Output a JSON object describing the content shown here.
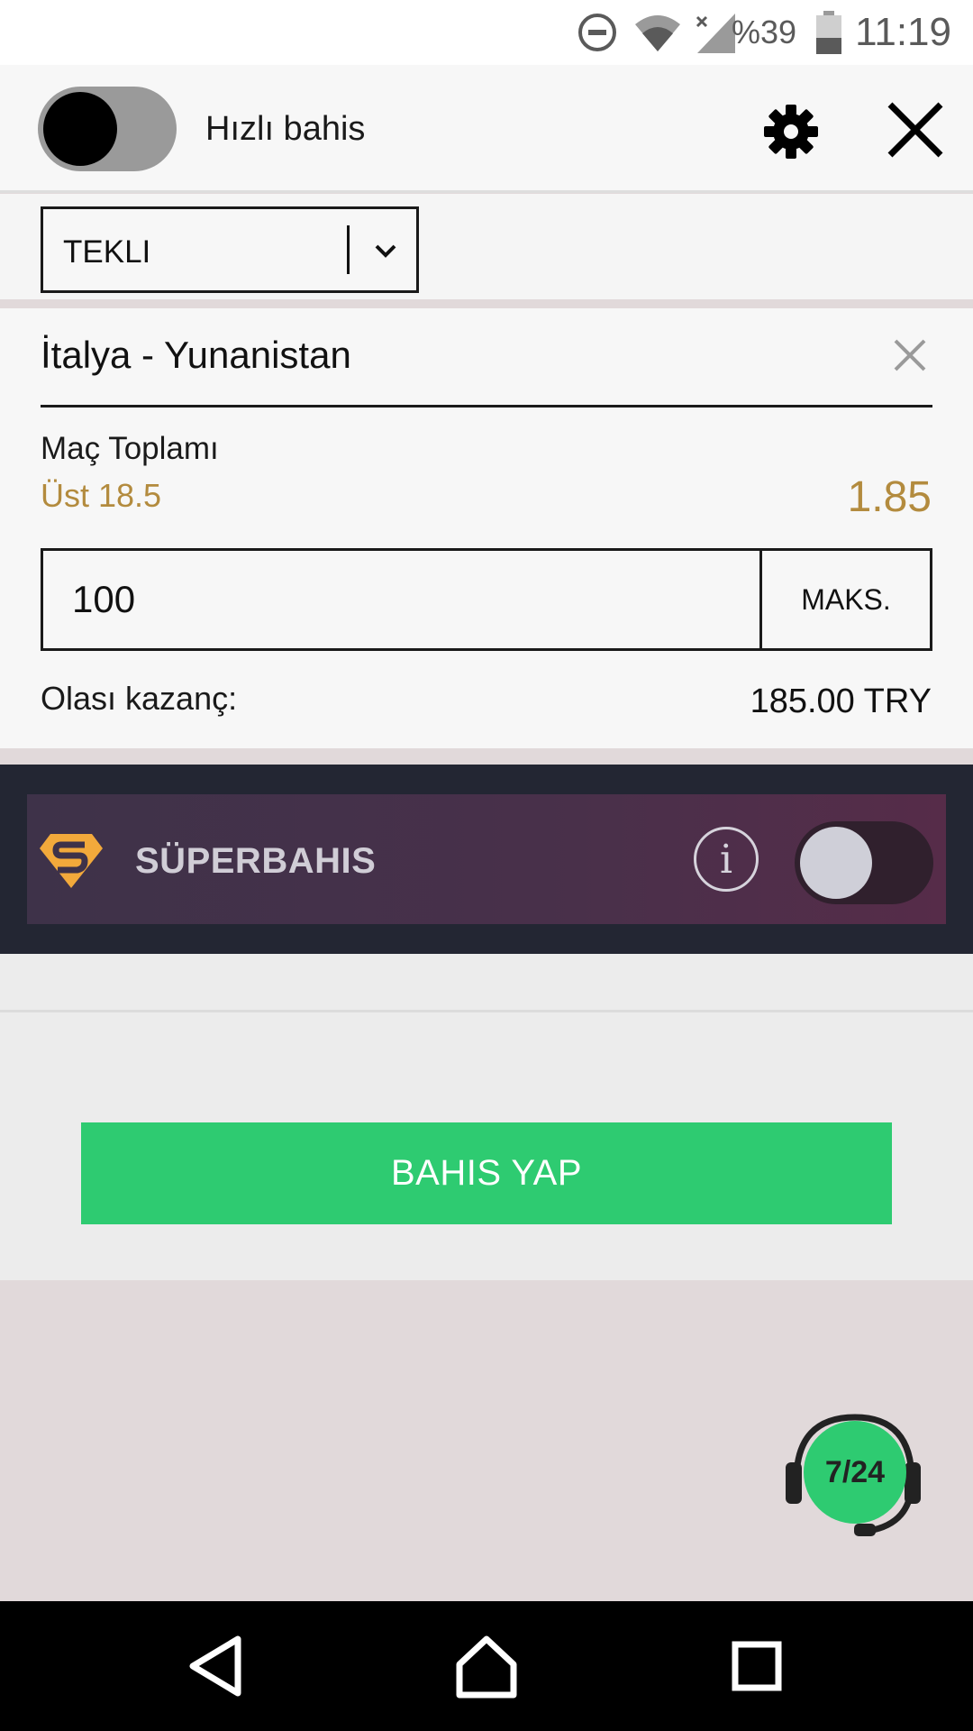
{
  "status_bar": {
    "battery": "%39",
    "time": "11:19",
    "icons": [
      "do-not-disturb-icon",
      "wifi-icon",
      "signal-icon",
      "battery-icon"
    ]
  },
  "header": {
    "quick_bet_label": "Hızlı bahis",
    "quick_bet_enabled": false
  },
  "bet_type": {
    "selected": "TEKLI"
  },
  "bet": {
    "match": "İtalya - Yunanistan",
    "market": "Maç Toplamı",
    "selection": "Üst 18.5",
    "odds": "1.85",
    "stake": "100",
    "max_label": "MAKS.",
    "potential_win_label": "Olası kazanç:",
    "potential_win_value": "185.00 TRY"
  },
  "superbahis": {
    "label": "SÜPERBAHIS",
    "info_glyph": "i",
    "enabled": false
  },
  "actions": {
    "place_bet_label": "BAHIS YAP"
  },
  "support": {
    "badge": "7/24"
  },
  "colors": {
    "accent_gold": "#b38b3e",
    "primary_green": "#2ecb71",
    "super_bg": "#232633"
  }
}
